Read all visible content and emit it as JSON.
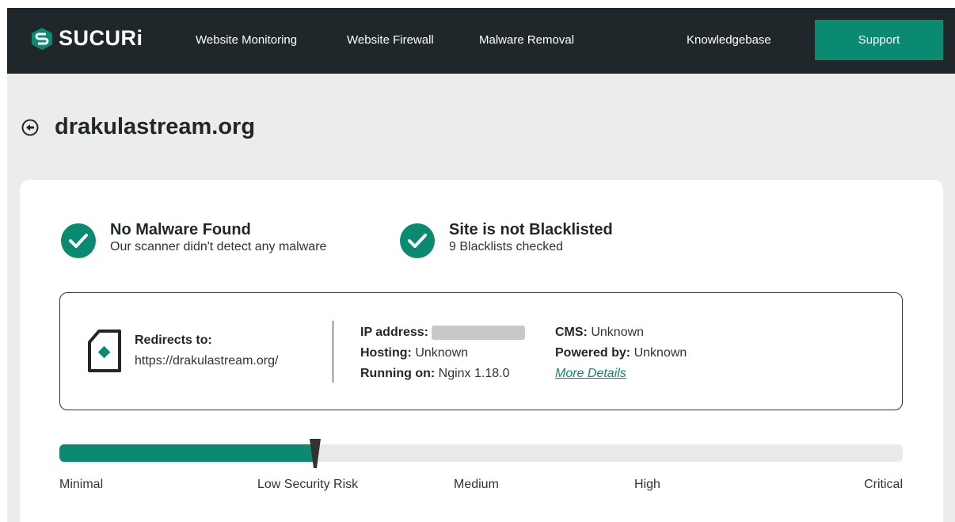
{
  "brand": {
    "name": "SUCURi",
    "accent": "#0b8a72",
    "dark": "#1f272b"
  },
  "nav": {
    "items": [
      "Website Monitoring",
      "Website Firewall",
      "Malware Removal",
      "Knowledgebase"
    ],
    "support": "Support"
  },
  "site": {
    "domain": "drakulastream.org"
  },
  "status": {
    "malware": {
      "title": "No Malware Found",
      "subtitle": "Our scanner didn't detect any malware"
    },
    "blacklist": {
      "title": "Site is not Blacklisted",
      "subtitle": "9 Blacklists checked"
    }
  },
  "details": {
    "redirect_label": "Redirects to:",
    "redirect_url": "https://drakulastream.org/",
    "ip_label": "IP address:",
    "hosting_label": "Hosting:",
    "hosting_value": "Unknown",
    "running_label": "Running on:",
    "running_value": "Nginx 1.18.0",
    "cms_label": "CMS:",
    "cms_value": "Unknown",
    "powered_label": "Powered by:",
    "powered_value": "Unknown",
    "more_details": "More Details"
  },
  "risk": {
    "level_fraction": 0.303,
    "labels": [
      "Minimal",
      "Low Security Risk",
      "Medium",
      "High",
      "Critical"
    ]
  },
  "icons": [
    "sucuri-logo-icon",
    "back-arrow-icon",
    "check-circle-icon",
    "site-document-icon",
    "risk-marker-icon"
  ]
}
